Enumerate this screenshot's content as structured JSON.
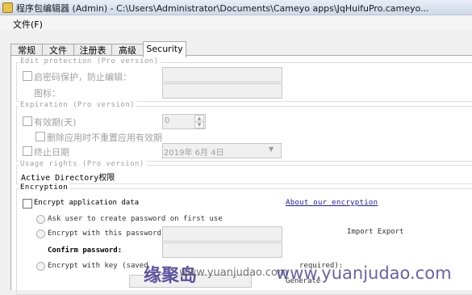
{
  "window": {
    "title": "程序包编辑器 (Admin) - C:\\Users\\Administrator\\Documents\\Cameyo apps\\JqHuifuPro.cameyo..."
  },
  "menu": {
    "file": "文件(F)"
  },
  "tabs": [
    {
      "label": "常规",
      "active": false
    },
    {
      "label": "文件",
      "active": false
    },
    {
      "label": "注册表",
      "active": false
    },
    {
      "label": "高级",
      "active": false
    },
    {
      "label": "Security",
      "active": true
    }
  ],
  "edit_protection": {
    "legend": "Edit protection (Pro version)",
    "password_label": "启密码保护，防止编辑：",
    "icon_label": "图标："
  },
  "expiration": {
    "legend": "Expiration (Pro version)",
    "validity_label": "有效期(天)",
    "validity_value": "0",
    "no_reset_label": "删除应用时不重置应用有效期",
    "end_date_label": "终止日期",
    "end_date_value": "2019年  6月  4日"
  },
  "usage_rights": {
    "legend": "Usage rights (Pro version)",
    "ad_label": "Active Directory权限"
  },
  "encryption": {
    "legend": "Encryption",
    "encrypt_label": "Encrypt application data",
    "about_link": "About our encryption",
    "ask_user_label": "Ask user to create password on first use",
    "this_password_label": "Encrypt with this password:",
    "import_export": "Import Export",
    "confirm_label": "Confirm password:",
    "key_label": "Encrypt with key (saved",
    "key_label_tail": "required):",
    "generate_label": "Generate"
  },
  "watermark": {
    "brand": "缘聚岛",
    "url": "www.yuanjudao.com",
    "url_overlay": "www.yuanjudao.com"
  },
  "colors": {
    "link": "#1a1aa6",
    "watermark": "#281e82"
  }
}
